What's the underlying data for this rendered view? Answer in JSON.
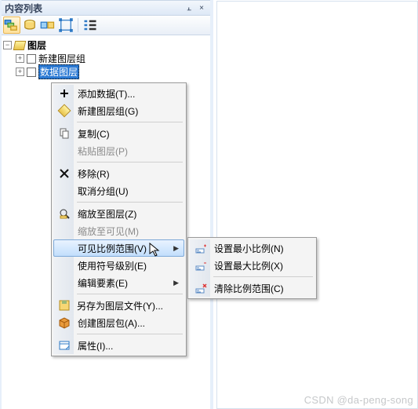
{
  "panel": {
    "title": "内容列表",
    "pin": "📌",
    "close": "×"
  },
  "tree": {
    "rootLabel": "图层",
    "group1": "新建图层组",
    "selected": "数据图层"
  },
  "context": {
    "addData": "添加数据(T)...",
    "newGroup": "新建图层组(G)",
    "copy": "复制(C)",
    "pasteLayer": "粘贴图层(P)",
    "remove": "移除(R)",
    "ungroup": "取消分组(U)",
    "zoomLayer": "缩放至图层(Z)",
    "zoomVisible": "缩放至可见(M)",
    "visibleScale": "可见比例范围(V)",
    "useSymbolLevel": "使用符号级别(E)",
    "editElement": "编辑要素(E)",
    "saveAsLayer": "另存为图层文件(Y)...",
    "createPkg": "创建图层包(A)...",
    "properties": "属性(I)..."
  },
  "submenu": {
    "setMin": "设置最小比例(N)",
    "setMax": "设置最大比例(X)",
    "clear": "清除比例范围(C)"
  },
  "watermark": "CSDN @da-peng-song"
}
